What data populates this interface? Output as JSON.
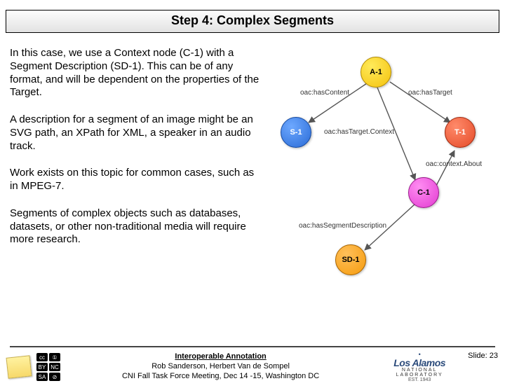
{
  "title": "Step 4: Complex Segments",
  "paragraphs": {
    "p1": "In this case, we use a Context node (C-1) with a Segment Description (SD-1).  This can be of any format, and will be dependent on the properties of the Target.",
    "p2": "A description for a segment of an image might be an SVG path, an XPath for XML, a speaker in an audio track.",
    "p3": "Work exists on this topic for common cases, such as in MPEG-7.",
    "p4": "Segments of complex objects such as databases, datasets, or other non-traditional media will require more research."
  },
  "diagram": {
    "nodes": {
      "a1": "A-1",
      "s1": "S-1",
      "t1": "T-1",
      "c1": "C-1",
      "sd1": "SD-1"
    },
    "edges": {
      "hasContent": "oac:hasContent",
      "hasTarget": "oac:hasTarget",
      "hasTargetContext": "oac:hasTarget.Context",
      "contextAbout": "oac:context.About",
      "hasSegmentDescription": "oac:hasSegmentDescription"
    }
  },
  "footer": {
    "title": "Interoperable Annotation",
    "authors": "Rob Sanderson, Herbert Van de Sompel",
    "venue": "CNI Fall Task Force Meeting, Dec 14 -15, Washington DC",
    "lanl_big": "Los Alamos",
    "lanl_lab": "NATIONAL LABORATORY",
    "lanl_est": "EST. 1943",
    "slide_label": "Slide: ",
    "slide_num": "23"
  }
}
